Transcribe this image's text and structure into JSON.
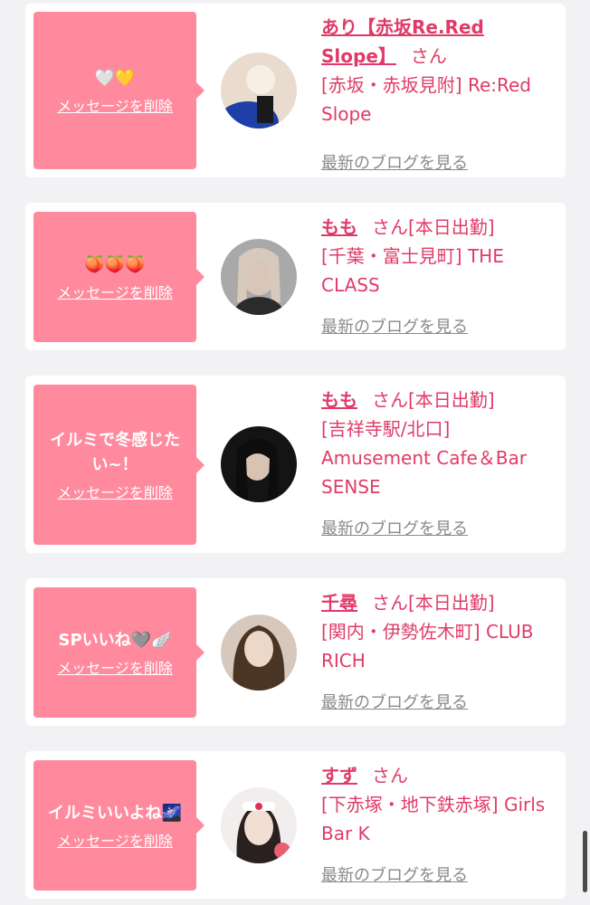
{
  "common": {
    "delete_label": "メッセージを削除",
    "san_label": "さん",
    "blog_label": "最新のブログを見る"
  },
  "cards": [
    {
      "message": "🤍💛",
      "name": "あり【赤坂Re.Red Slope】",
      "status": "",
      "shop": "[赤坂・赤坂見附] Re:Red Slope",
      "avatar_colors": [
        "#f2e6da",
        "#1f3fa8",
        "#8a6a4a"
      ]
    },
    {
      "message": "🍑🍑🍑",
      "name": "もも",
      "status": "[本日出勤]",
      "shop": "[千葉・富士見町] THE CLASS",
      "avatar_colors": [
        "#b8b8b8",
        "#3c3c3c",
        "#e8d8cc"
      ]
    },
    {
      "message": "イルミで冬感じた\nい~！",
      "name": "もも",
      "status": "[本日出勤]",
      "shop": "[吉祥寺駅/北口] Amusement Cafe＆Bar SENSE",
      "avatar_colors": [
        "#1a1a1a",
        "#2a2a2a",
        "#d8c0b0"
      ]
    },
    {
      "message": "SPいいね🩶🪽",
      "name": "千尋",
      "status": "[本日出勤]",
      "shop": "[関内・伊勢佐木町] CLUB RICH",
      "avatar_colors": [
        "#5a4030",
        "#e8d0c0",
        "#3a2a20"
      ]
    },
    {
      "message": "イルミいいよね🌌",
      "name": "すず",
      "status": "",
      "shop": "[下赤塚・地下鉄赤塚] Girls Bar K",
      "avatar_colors": [
        "#f4f0f0",
        "#e03050",
        "#2a2020"
      ]
    }
  ]
}
